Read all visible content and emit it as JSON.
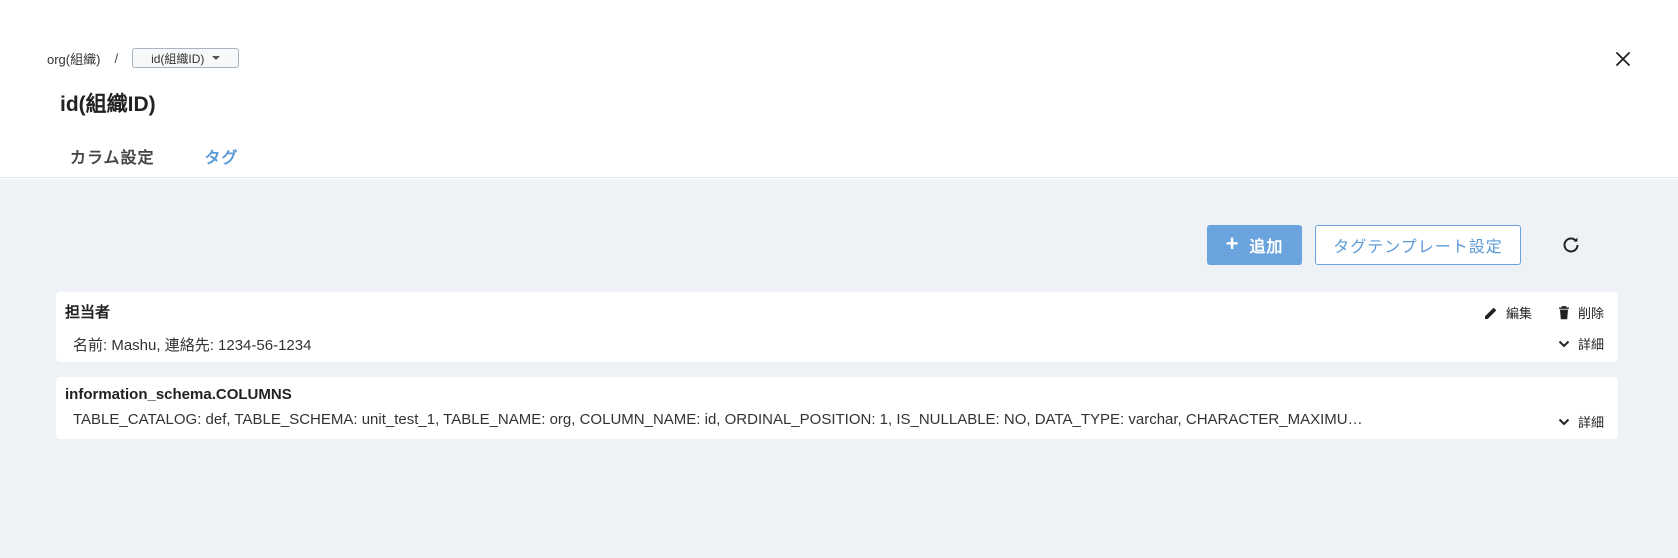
{
  "breadcrumb": {
    "parent": "org(組織)",
    "separator": "/",
    "current": "id(組織ID)"
  },
  "page_title": "id(組織ID)",
  "tabs": [
    {
      "label": "カラム設定",
      "active": false
    },
    {
      "label": "タグ",
      "active": true
    }
  ],
  "toolbar": {
    "add_label": "追加",
    "template_label": "タグテンプレート設定"
  },
  "cards": [
    {
      "title": "担当者",
      "body": "名前: Mashu, 連絡先: 1234-56-1234",
      "edit_label": "編集",
      "delete_label": "削除",
      "detail_label": "詳細"
    },
    {
      "title": "information_schema.COLUMNS",
      "body": "TABLE_CATALOG: def, TABLE_SCHEMA: unit_test_1, TABLE_NAME: org, COLUMN_NAME: id, ORDINAL_POSITION: 1, IS_NULLABLE: NO, DATA_TYPE: varchar, CHARACTER_MAXIMU…",
      "detail_label": "詳細"
    }
  ],
  "icons": {
    "close": "close-icon",
    "caret": "caret-down-icon",
    "plus": "plus-icon",
    "refresh": "refresh-icon",
    "edit": "pencil-icon",
    "delete": "trash-icon",
    "chevron": "chevron-down-icon"
  },
  "colors": {
    "accent": "#5a9bd8",
    "accent_fill": "#6aa3dd",
    "content_bg": "#eef2f7"
  }
}
